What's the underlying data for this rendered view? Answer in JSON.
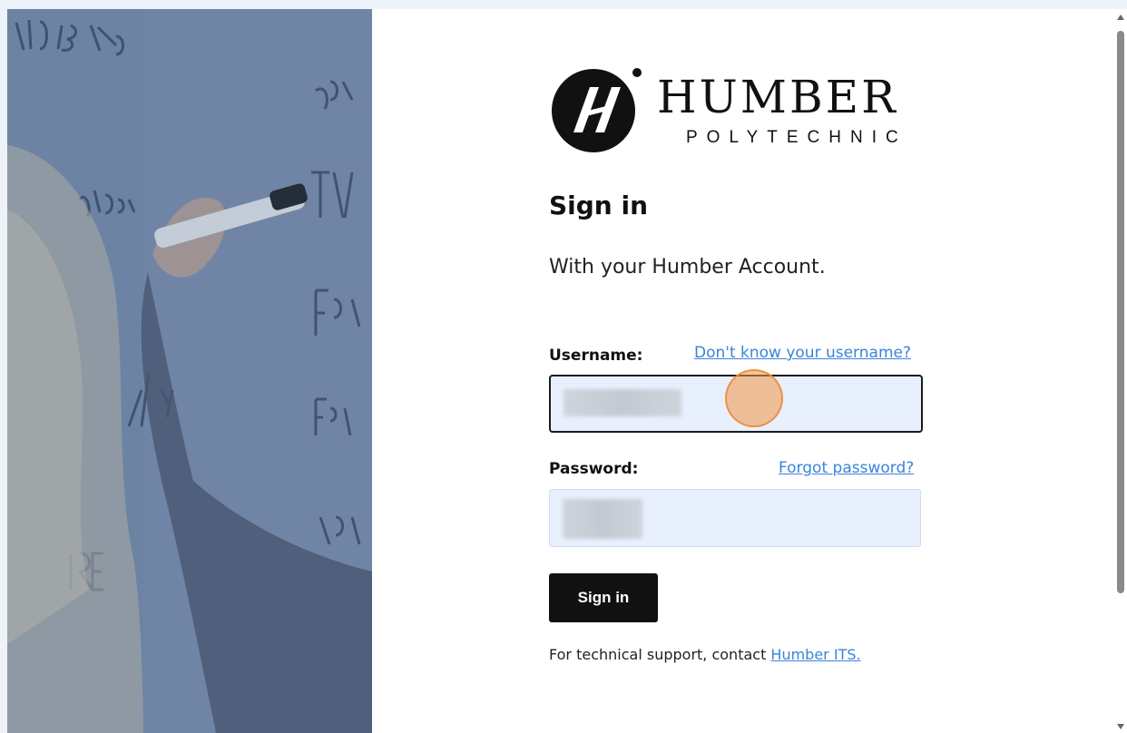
{
  "brand": {
    "name": "HUMBER",
    "subname": "POLYTECHNIC"
  },
  "login": {
    "title": "Sign in",
    "subtitle": "With your Humber Account.",
    "username_label": "Username:",
    "username_help_link": "Don't know your username?",
    "password_label": "Password:",
    "password_help_link": "Forgot password?",
    "submit_label": "Sign in",
    "support_text": "For technical support, contact ",
    "support_link": "Humber ITS."
  },
  "colors": {
    "link": "#3a84d9",
    "button_bg": "#111111",
    "input_bg": "#e8f0fe",
    "hero_overlay": "#6e82a1"
  },
  "icons": {
    "logo_mark": "humber-h-logo-icon"
  }
}
